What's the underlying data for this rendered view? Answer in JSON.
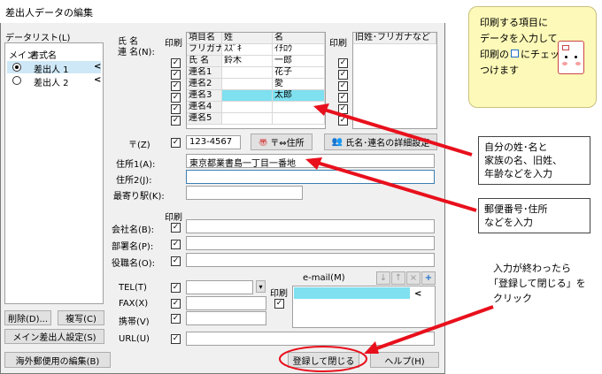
{
  "window": {
    "title": "差出人データの編集"
  },
  "datalist": {
    "label": "データリスト(L)",
    "col_main": "メイン",
    "col_name": "書式名",
    "items": [
      {
        "name": "差出人 1",
        "arrow": "<"
      },
      {
        "name": "差出人 2",
        "arrow": "<"
      }
    ],
    "delete_btn": "削除(D)...",
    "copy_btn": "複写(C)",
    "main_setting_btn": "メイン差出人設定(S)"
  },
  "name_section": {
    "label_line1": "氏 名",
    "label_line2": "連 名(N):",
    "print_label": "印刷",
    "print_label_right": "印刷",
    "headers": [
      "項目名",
      "姓",
      "名"
    ],
    "rows": [
      {
        "item": "フリガナ",
        "sei": "ｽｽﾞｷ",
        "mei": "ｲﾁﾛｳ"
      },
      {
        "item": "氏 名",
        "sei": "鈴木",
        "mei": "一郎"
      },
      {
        "item": "連名1",
        "sei": "",
        "mei": "花子"
      },
      {
        "item": "連名2",
        "sei": "",
        "mei": "愛"
      },
      {
        "item": "連名3",
        "sei": "",
        "mei": "太郎"
      },
      {
        "item": "連名4",
        "sei": "",
        "mei": ""
      },
      {
        "item": "連名5",
        "sei": "",
        "mei": ""
      }
    ],
    "right_header": "旧姓･フリガナなど"
  },
  "address": {
    "postal_label": "〒(Z)",
    "postal_value": "123-4567",
    "postal_btn": "〒⇔住所",
    "detail_btn": "氏名･連名の詳細設定",
    "addr1_label": "住所1(A):",
    "addr1_value": "東京都業書島一丁目一番地",
    "addr2_label": "住所2(J):",
    "station_label": "最寄り駅(K):"
  },
  "company": {
    "print_label": "印刷",
    "company_label": "会社名(B):",
    "dept_label": "部署名(P):",
    "title_label": "役職名(O):"
  },
  "contact": {
    "tel_label": "TEL(T)",
    "fax_label": "FAX(X)",
    "mobile_label": "携帯(V)",
    "url_label": "URL(U)",
    "print_label": "印刷",
    "email_label": "e-mail(M)",
    "email_btns": [
      "↓",
      "↑",
      "×",
      "+"
    ]
  },
  "footer": {
    "overseas_btn": "海外郵便用の編集(B)",
    "register_btn": "登録して閉じる",
    "help_btn": "ヘルプ(H)"
  },
  "annotations": {
    "tip_top": [
      "印刷する項目に",
      "データを入力して",
      "印刷の",
      "にチェックを",
      "つけます"
    ],
    "tip_name": [
      "自分の姓･名と",
      "家族の名、旧姓、",
      "年齢などを入力"
    ],
    "tip_address": [
      "郵便番号･住所",
      "などを入力"
    ],
    "tip_register": [
      "入力が終わったら",
      "「登録して閉じる」を",
      "クリック"
    ]
  },
  "colors": {
    "highlight": "#7fe0f0",
    "arrow": "#e8101c",
    "tip_bg": "#fdf9b8"
  }
}
